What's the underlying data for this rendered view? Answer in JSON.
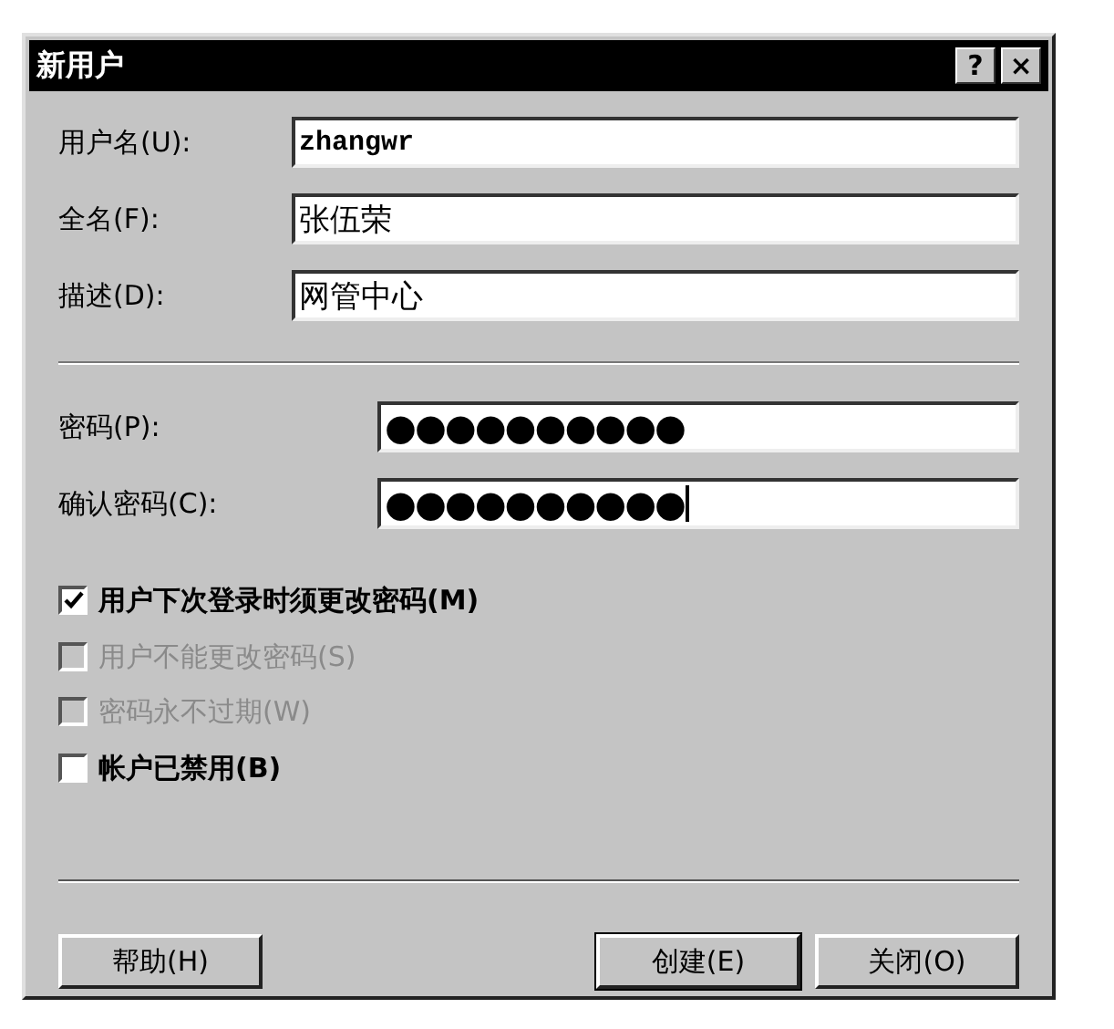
{
  "window": {
    "title": "新用户",
    "title_buttons": [
      "?",
      "×"
    ]
  },
  "fields": [
    {
      "label": "用户名(U):",
      "value": "zhangwr",
      "kind": "mono"
    },
    {
      "label": "全名(F):",
      "value": "张伍荣",
      "kind": "plain"
    },
    {
      "label": "描述(D):",
      "value": "网管中心",
      "kind": "plain"
    }
  ],
  "password_fields": [
    {
      "label": "密码(P):",
      "value": "●●●●●●●●●●",
      "focused": false
    },
    {
      "label": "确认密码(C):",
      "value": "●●●●●●●●●●",
      "focused": true
    }
  ],
  "checkboxes": [
    {
      "label": "用户下次登录时须更改密码(M)",
      "checked": true,
      "disabled": false
    },
    {
      "label": "用户不能更改密码(S)",
      "checked": false,
      "disabled": true
    },
    {
      "label": "密码永不过期(W)",
      "checked": false,
      "disabled": true
    },
    {
      "label": "帐户已禁用(B)",
      "checked": false,
      "disabled": false
    }
  ],
  "buttons": [
    {
      "label": "帮助(H)",
      "default": false
    },
    {
      "label": "创建(E)",
      "default": true
    },
    {
      "label": "关闭(O)",
      "default": false
    }
  ]
}
